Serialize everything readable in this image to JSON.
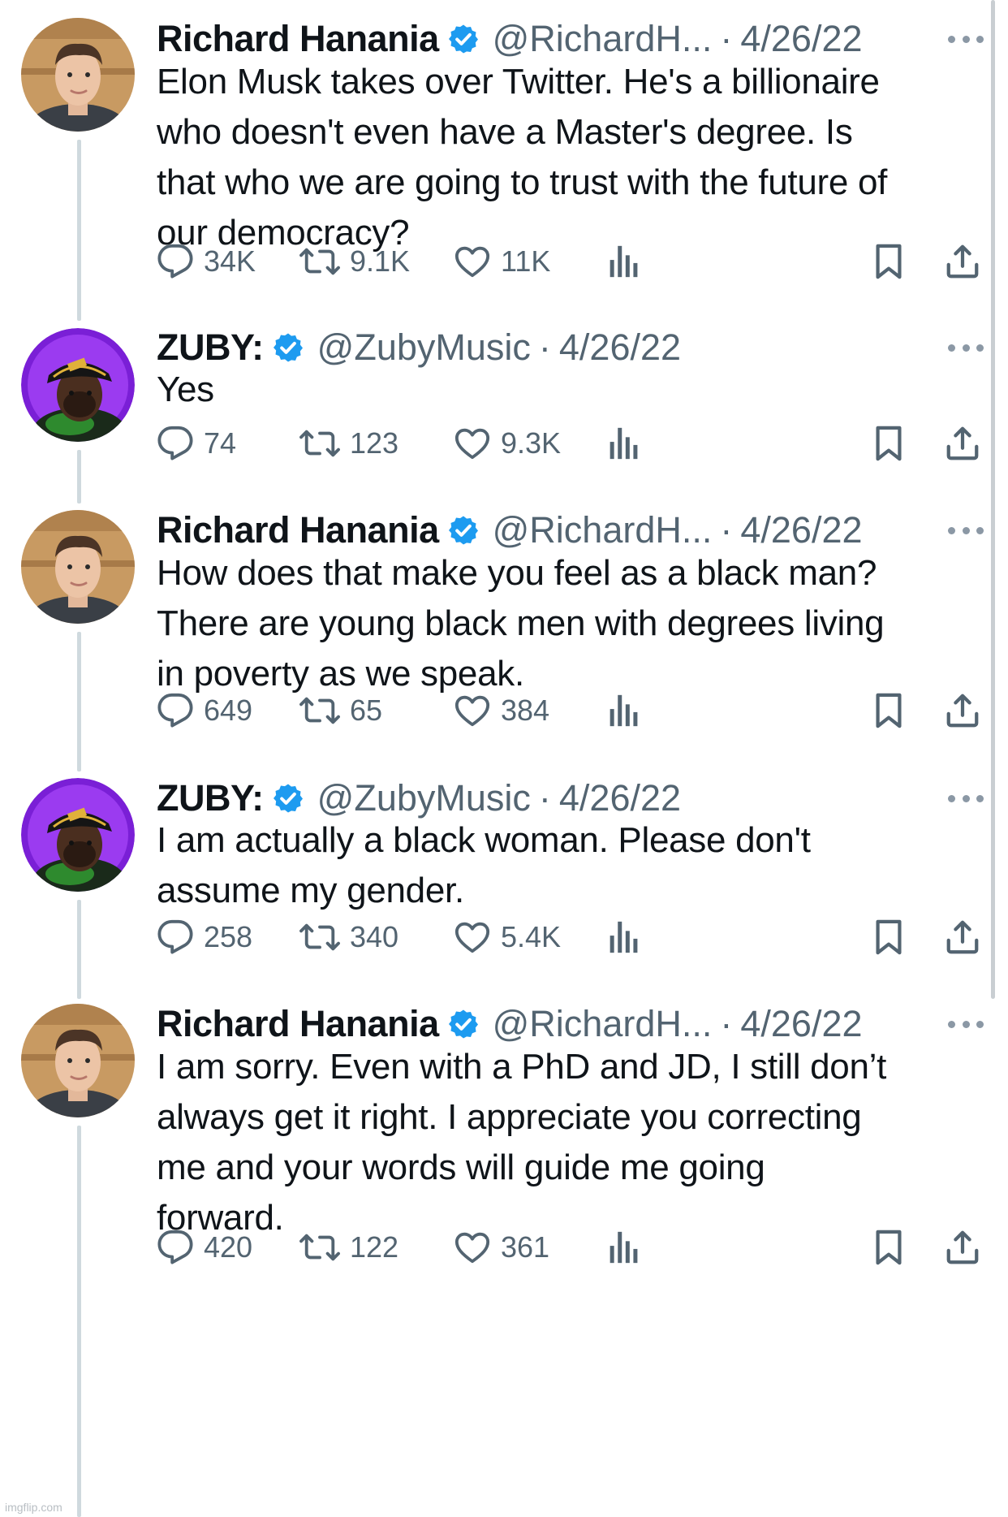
{
  "thread": {
    "tweets": [
      {
        "author": "richard",
        "name": "Richard Hanania",
        "handle": "@RichardH...",
        "separator": "·",
        "date": "4/26/22",
        "text": "Elon Musk takes over Twitter. He's a billionaire\nwho doesn't even have a Master's degree. Is\nthat who we are going to trust with the future of\nour democracy?",
        "replies": "34K",
        "retweets": "9.1K",
        "likes": "11K"
      },
      {
        "author": "zuby",
        "name": "ZUBY:",
        "handle": "@ZubyMusic",
        "separator": "·",
        "date": "4/26/22",
        "text": "Yes",
        "replies": "74",
        "retweets": "123",
        "likes": "9.3K"
      },
      {
        "author": "richard",
        "name": "Richard Hanania",
        "handle": "@RichardH...",
        "separator": "·",
        "date": "4/26/22",
        "text": "How does that make you feel as a black man?\nThere are young black men with degrees living\nin poverty as we speak.",
        "replies": "649",
        "retweets": "65",
        "likes": "384"
      },
      {
        "author": "zuby",
        "name": "ZUBY:",
        "handle": "@ZubyMusic",
        "separator": "·",
        "date": "4/26/22",
        "text": "I am actually a black woman. Please don't\nassume my gender.",
        "replies": "258",
        "retweets": "340",
        "likes": "5.4K"
      },
      {
        "author": "richard",
        "name": "Richard Hanania",
        "handle": "@RichardH...",
        "separator": "·",
        "date": "4/26/22",
        "text": "I am sorry. Even with a PhD and JD, I still don’t\nalways get it right. I appreciate you correcting\nme and your words will guide me going\nforward.",
        "replies": "420",
        "retweets": "122",
        "likes": "361"
      }
    ]
  },
  "watermark": "imgflip.com",
  "colors": {
    "verified": "#1d9bf0",
    "secondary_text": "#536471",
    "thread_line": "#cfd9de",
    "icon": "#536471"
  },
  "icons": {
    "reply": "speech-bubble-icon",
    "retweet": "retweet-arrows-icon",
    "like": "heart-icon",
    "views": "bar-chart-icon",
    "bookmark": "bookmark-icon",
    "share": "share-upload-icon",
    "verified": "verified-badge-icon",
    "more": "more-dots-icon"
  }
}
